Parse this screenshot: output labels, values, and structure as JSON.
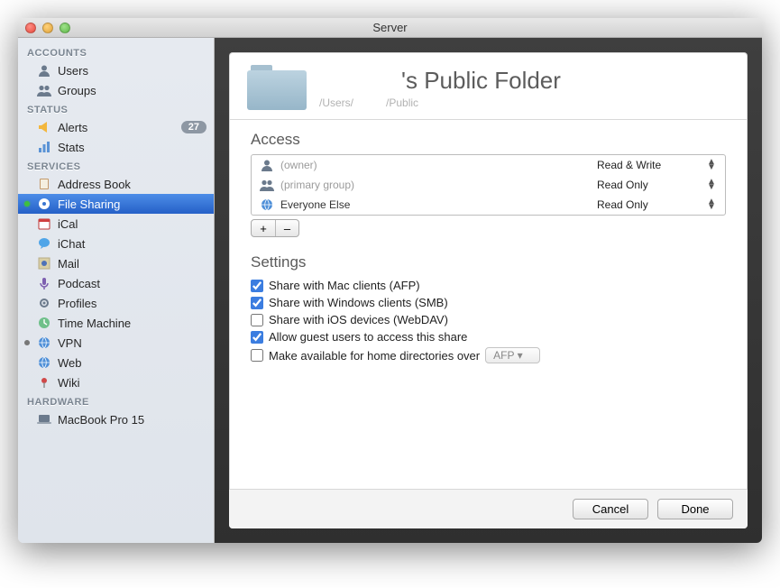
{
  "window": {
    "title": "Server"
  },
  "sidebar": {
    "sections": [
      {
        "label": "ACCOUNTS",
        "items": [
          {
            "id": "users",
            "label": "Users",
            "icon": "person"
          },
          {
            "id": "groups",
            "label": "Groups",
            "icon": "people"
          }
        ]
      },
      {
        "label": "STATUS",
        "items": [
          {
            "id": "alerts",
            "label": "Alerts",
            "icon": "megaphone",
            "badge": "27"
          },
          {
            "id": "stats",
            "label": "Stats",
            "icon": "bars"
          }
        ]
      },
      {
        "label": "SERVICES",
        "items": [
          {
            "id": "addressbook",
            "label": "Address Book",
            "icon": "book"
          },
          {
            "id": "filesharing",
            "label": "File Sharing",
            "icon": "disc",
            "selected": true,
            "dot": "green"
          },
          {
            "id": "ical",
            "label": "iCal",
            "icon": "cal"
          },
          {
            "id": "ichat",
            "label": "iChat",
            "icon": "bubble"
          },
          {
            "id": "mail",
            "label": "Mail",
            "icon": "stamp"
          },
          {
            "id": "podcast",
            "label": "Podcast",
            "icon": "mic"
          },
          {
            "id": "profiles",
            "label": "Profiles",
            "icon": "gears"
          },
          {
            "id": "timemachine",
            "label": "Time Machine",
            "icon": "clock"
          },
          {
            "id": "vpn",
            "label": "VPN",
            "icon": "globep",
            "dot": "grey"
          },
          {
            "id": "web",
            "label": "Web",
            "icon": "globe"
          },
          {
            "id": "wiki",
            "label": "Wiki",
            "icon": "pin"
          }
        ]
      },
      {
        "label": "HARDWARE",
        "items": [
          {
            "id": "mbp15",
            "label": "MacBook Pro 15",
            "icon": "laptop"
          }
        ]
      }
    ]
  },
  "header": {
    "title": "'s Public Folder",
    "path_prefix": "/Users/",
    "path_suffix": "/Public"
  },
  "access": {
    "title": "Access",
    "rows": [
      {
        "icon": "person",
        "name": "",
        "hint": "(owner)",
        "perm": "Read & Write"
      },
      {
        "icon": "people",
        "name": "",
        "hint": "(primary group)",
        "perm": "Read Only"
      },
      {
        "icon": "globe",
        "name": "Everyone Else",
        "hint": "",
        "perm": "Read Only"
      }
    ],
    "add_label": "+",
    "remove_label": "–"
  },
  "settings": {
    "title": "Settings",
    "rows": [
      {
        "id": "afp",
        "label": "Share with Mac clients (AFP)",
        "checked": true
      },
      {
        "id": "smb",
        "label": "Share with Windows clients (SMB)",
        "checked": true
      },
      {
        "id": "webdav",
        "label": "Share with iOS devices (WebDAV)",
        "checked": false
      },
      {
        "id": "guest",
        "label": "Allow guest users to access this share",
        "checked": true
      },
      {
        "id": "homes",
        "label": "Make available for home directories over",
        "checked": false,
        "select": "AFP"
      }
    ]
  },
  "footer": {
    "cancel": "Cancel",
    "done": "Done"
  }
}
